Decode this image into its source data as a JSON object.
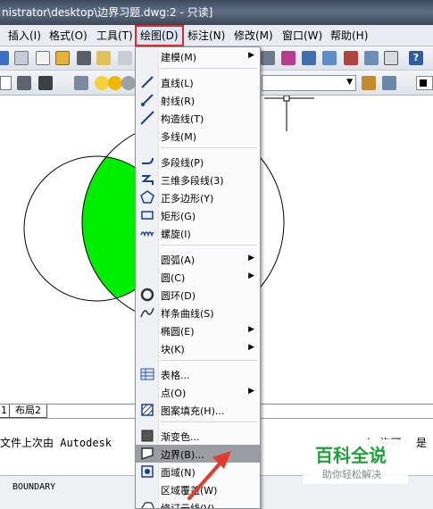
{
  "window": {
    "title": "nistrator\\desktop\\边界习题.dwg:2 - 只读]"
  },
  "menubar": {
    "items": [
      {
        "label": "插入(I)"
      },
      {
        "label": "格式(O)"
      },
      {
        "label": "工具(T)"
      },
      {
        "label": "绘图(D)"
      },
      {
        "label": "标注(N)"
      },
      {
        "label": "修改(M)"
      },
      {
        "label": "窗口(W)"
      },
      {
        "label": "帮助(H)"
      }
    ]
  },
  "draw_menu": {
    "items": [
      {
        "label": "建模(M)",
        "has_submenu": true,
        "icon": ""
      },
      {
        "label": "直线(L)",
        "has_submenu": false,
        "icon": "line-icon"
      },
      {
        "label": "射线(R)",
        "has_submenu": false,
        "icon": "ray-icon"
      },
      {
        "label": "构造线(T)",
        "has_submenu": false,
        "icon": "xline-icon"
      },
      {
        "label": "多线(M)",
        "has_submenu": false,
        "icon": ""
      },
      {
        "label": "多段线(P)",
        "has_submenu": false,
        "icon": "polyline-icon"
      },
      {
        "label": "三维多段线(3)",
        "has_submenu": false,
        "icon": "3d-polyline-icon"
      },
      {
        "label": "正多边形(Y)",
        "has_submenu": false,
        "icon": "polygon-icon"
      },
      {
        "label": "矩形(G)",
        "has_submenu": false,
        "icon": "rectangle-icon"
      },
      {
        "label": "螺旋(I)",
        "has_submenu": false,
        "icon": "helix-icon"
      },
      {
        "label": "圆弧(A)",
        "has_submenu": true,
        "icon": ""
      },
      {
        "label": "圆(C)",
        "has_submenu": true,
        "icon": ""
      },
      {
        "label": "圆环(D)",
        "has_submenu": false,
        "icon": "donut-icon"
      },
      {
        "label": "样条曲线(S)",
        "has_submenu": false,
        "icon": "spline-icon"
      },
      {
        "label": "椭圆(E)",
        "has_submenu": true,
        "icon": ""
      },
      {
        "label": "块(K)",
        "has_submenu": true,
        "icon": ""
      },
      {
        "label": "表格...",
        "has_submenu": false,
        "icon": "table-icon"
      },
      {
        "label": "点(O)",
        "has_submenu": true,
        "icon": ""
      },
      {
        "label": "图案填充(H)...",
        "has_submenu": false,
        "icon": "hatch-icon"
      },
      {
        "label": "渐变色...",
        "has_submenu": false,
        "icon": "gradient-icon"
      },
      {
        "label": "边界(B)...",
        "has_submenu": false,
        "icon": "boundary-icon",
        "highlighted": true
      },
      {
        "label": "面域(N)",
        "has_submenu": false,
        "icon": "region-icon"
      },
      {
        "label": "区域覆盖(W)",
        "has_submenu": false,
        "icon": ""
      },
      {
        "label": "修订云线(V)",
        "has_submenu": false,
        "icon": "revcloud-icon"
      }
    ]
  },
  "layout_tabs": [
    "1",
    "布局2"
  ],
  "command_line": {
    "text": "文件上次由 Autodesk",
    "text_right": "k 许可",
    "tail": "是"
  },
  "status": {
    "text": "BOUNDARY"
  },
  "watermark": {
    "title": "百科全说",
    "subtitle": "助你轻松解决"
  },
  "colors": {
    "fill": "#00ee00",
    "highlight": "#9a9da3",
    "active_menu_border": "#e02a2a",
    "watermark_green": "#1fa03a"
  }
}
